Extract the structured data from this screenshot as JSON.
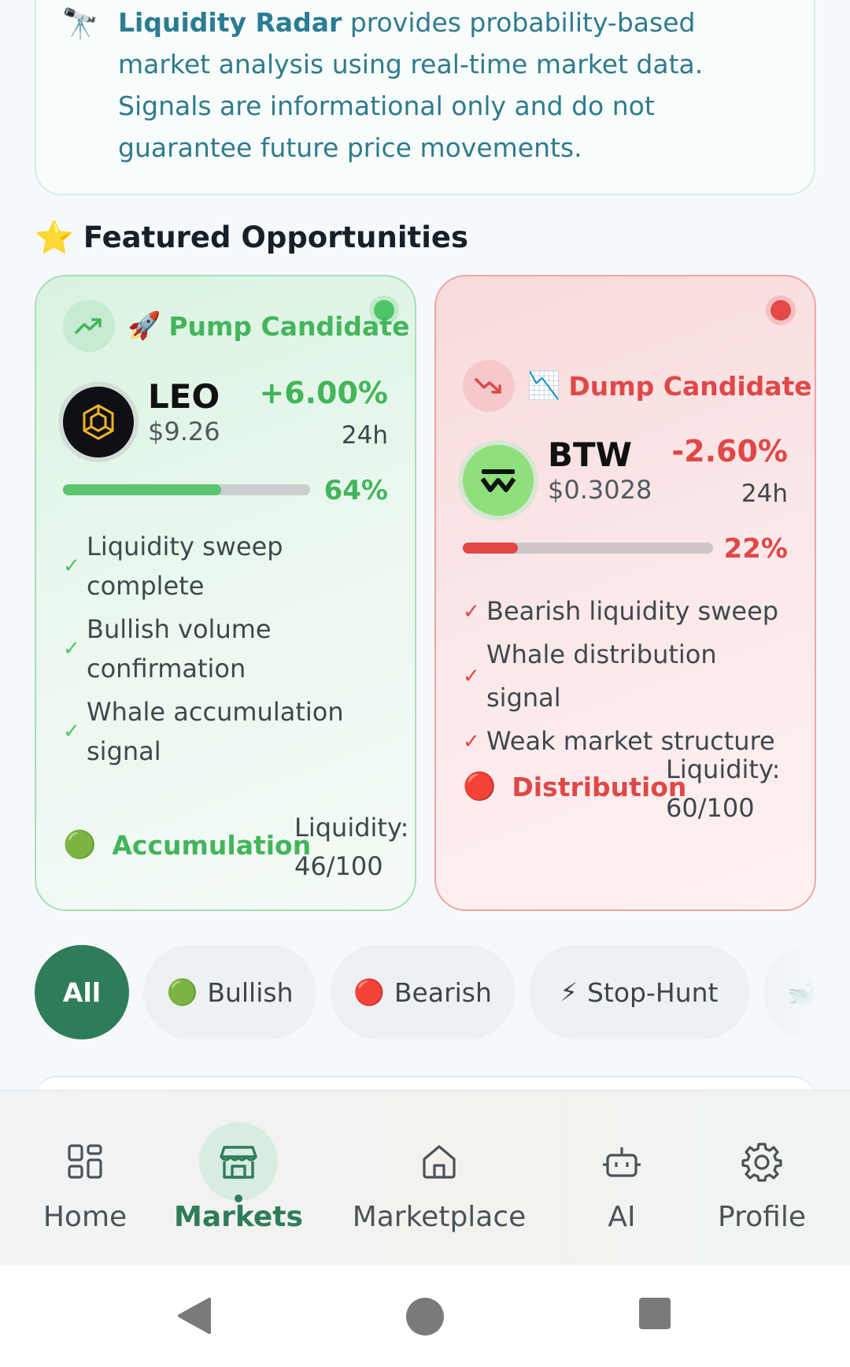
{
  "info": {
    "icon": "telescope-icon",
    "brand": "Liquidity Radar",
    "text": " provides probability-based market analysis using real-time market data. Signals are informational only and do not guarantee future price movements."
  },
  "featured": {
    "icon": "star-icon",
    "title": "Featured Opportunities"
  },
  "cards": [
    {
      "type": "pump",
      "label": "Pump Candidate",
      "trend_icon": "trending-up-icon",
      "emoji_icon": "rocket-icon",
      "symbol": "LEO",
      "price": "$9.26",
      "change": "+6.00%",
      "period": "24h",
      "score_pct": "64%",
      "score_fraction": 0.64,
      "signals": [
        "Liquidity sweep complete",
        "Bullish volume confirmation",
        "Whale accumulation signal"
      ],
      "phase_icon": "green-circle-icon",
      "phase": "Accumulation",
      "liquidity_label": "Liquidity:",
      "liquidity_value": "46/100",
      "accent": "#43b55b"
    },
    {
      "type": "dump",
      "label": "Dump Candidate",
      "trend_icon": "trending-down-icon",
      "emoji_icon": "chart-decreasing-icon",
      "symbol": "BTW",
      "price": "$0.3028",
      "change": "-2.60%",
      "period": "24h",
      "score_pct": "22%",
      "score_fraction": 0.22,
      "signals": [
        "Bearish liquidity sweep",
        "Whale distribution signal",
        "Weak market structure"
      ],
      "phase_icon": "red-circle-icon",
      "phase": "Distribution",
      "liquidity_label": "Liquidity:",
      "liquidity_value": "60/100",
      "accent": "#e04848"
    }
  ],
  "filters": [
    {
      "label": "All",
      "icon": "",
      "active": true
    },
    {
      "label": "Bullish",
      "icon": "green-circle-icon",
      "active": false
    },
    {
      "label": "Bearish",
      "icon": "red-circle-icon",
      "active": false
    },
    {
      "label": "Stop-Hunt",
      "icon": "lightning-icon",
      "active": false
    },
    {
      "label": "",
      "icon": "whale-icon",
      "active": false
    }
  ],
  "nav": [
    {
      "label": "Home",
      "icon": "grid-icon",
      "active": false
    },
    {
      "label": "Markets",
      "icon": "store-icon",
      "active": true
    },
    {
      "label": "Marketplace",
      "icon": "house-icon",
      "active": false
    },
    {
      "label": "AI",
      "icon": "robot-icon",
      "active": false
    },
    {
      "label": "Profile",
      "icon": "gear-icon",
      "active": false
    }
  ],
  "colors": {
    "primary": "#2e7d58",
    "bullish": "#43b55b",
    "bearish": "#e04848",
    "info_text": "#2f7b8e"
  }
}
